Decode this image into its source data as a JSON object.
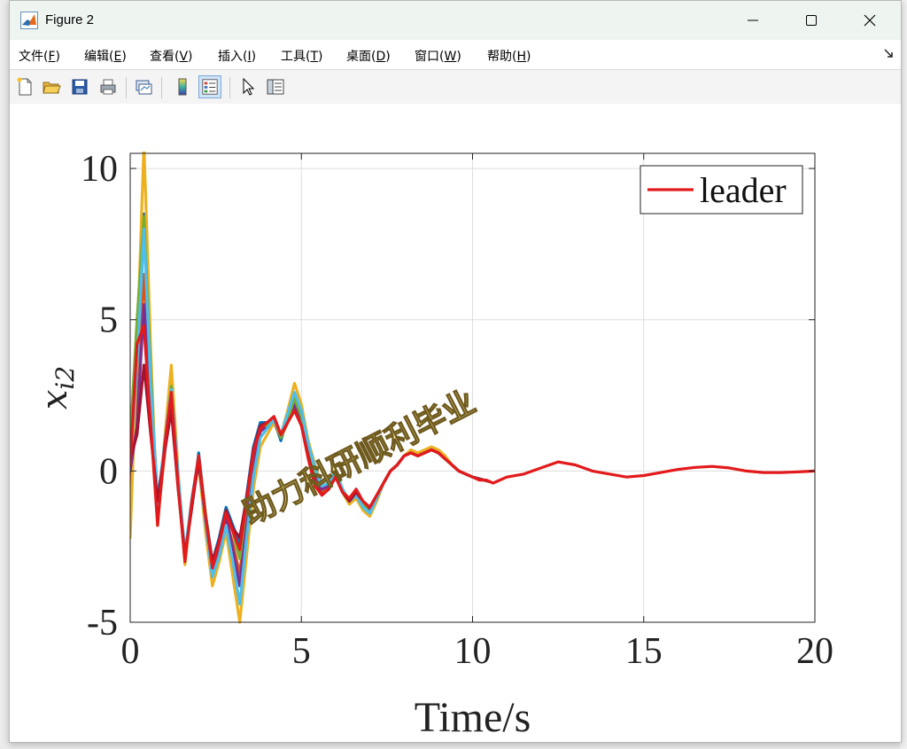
{
  "window": {
    "title": "Figure 2",
    "icons": {
      "app": "matlab-icon",
      "minimize": "minimize-icon",
      "maximize": "maximize-icon",
      "close": "close-icon"
    }
  },
  "menu": {
    "items": [
      {
        "label": "文件(",
        "key": "F",
        "tail": ")"
      },
      {
        "label": "编辑(",
        "key": "E",
        "tail": ")"
      },
      {
        "label": "查看(",
        "key": "V",
        "tail": ")"
      },
      {
        "label": "插入(",
        "key": "I",
        "tail": ")"
      },
      {
        "label": "工具(",
        "key": "T",
        "tail": ")"
      },
      {
        "label": "桌面(",
        "key": "D",
        "tail": ")"
      },
      {
        "label": "窗口(",
        "key": "W",
        "tail": ")"
      },
      {
        "label": "帮助(",
        "key": "H",
        "tail": ")"
      }
    ],
    "overflow_icon": "dock-arrow-icon"
  },
  "toolbar": {
    "tools": [
      "new-figure-icon",
      "open-file-icon",
      "save-icon",
      "print-icon",
      "link-plot-icon",
      "colorbar-icon",
      "legend-icon",
      "edit-plot-icon",
      "property-inspector-icon"
    ]
  },
  "watermark": "助力科研顺利毕业",
  "colors": {
    "leader": "#e31a1c",
    "accent_title": "#eef5f1"
  },
  "chart_data": {
    "type": "line",
    "xlabel": "Time/s",
    "ylabel": "x_{i2}",
    "xlim": [
      0,
      20
    ],
    "ylim": [
      -5,
      10.5
    ],
    "xticks": [
      0,
      5,
      10,
      15,
      20
    ],
    "xtick_labels": [
      "0",
      "5",
      "10",
      "15",
      "20"
    ],
    "yticks": [
      -5,
      0,
      5,
      10
    ],
    "ytick_labels": [
      "-5",
      "0",
      "5",
      "10"
    ],
    "grid": true,
    "legend": {
      "entries": [
        "leader"
      ],
      "position": "top-right"
    },
    "leader": {
      "name": "leader",
      "color": "#e31a1c",
      "x": [
        0,
        0.2,
        0.4,
        0.6,
        0.8,
        1,
        1.2,
        1.4,
        1.6,
        1.8,
        2,
        2.2,
        2.4,
        2.6,
        2.8,
        3,
        3.2,
        3.4,
        3.6,
        3.8,
        4,
        4.2,
        4.4,
        4.6,
        4.8,
        5,
        5.2,
        5.4,
        5.6,
        5.8,
        6,
        6.2,
        6.4,
        6.6,
        6.8,
        7,
        7.2,
        7.4,
        7.6,
        7.8,
        8,
        8.2,
        8.4,
        8.6,
        8.8,
        9,
        9.2,
        9.4,
        9.6,
        9.8,
        10,
        10.2,
        10.4,
        10.6,
        10.8,
        11,
        11.5,
        12,
        12.5,
        13,
        13.5,
        14,
        14.5,
        15,
        15.5,
        16,
        16.5,
        17,
        17.5,
        18,
        18.5,
        19,
        19.5,
        20
      ],
      "y": [
        0.2,
        4.2,
        4.8,
        1.5,
        -1.8,
        0.8,
        2.6,
        -0.5,
        -3.0,
        -1.0,
        0.5,
        -1.5,
        -3.2,
        -2.4,
        -1.4,
        -2.0,
        -2.6,
        -1.0,
        0.6,
        1.4,
        1.6,
        1.8,
        1.2,
        1.6,
        2.0,
        1.5,
        0.4,
        -0.5,
        -0.8,
        -0.6,
        -0.2,
        -0.7,
        -0.9,
        -0.6,
        -1.0,
        -1.2,
        -0.8,
        -0.4,
        0.0,
        0.2,
        0.5,
        0.6,
        0.5,
        0.6,
        0.7,
        0.6,
        0.4,
        0.2,
        0.0,
        -0.1,
        -0.2,
        -0.3,
        -0.3,
        -0.4,
        -0.3,
        -0.2,
        -0.1,
        0.1,
        0.3,
        0.2,
        0.0,
        -0.1,
        -0.2,
        -0.15,
        -0.05,
        0.05,
        0.12,
        0.15,
        0.1,
        0.0,
        -0.05,
        -0.05,
        -0.03,
        0.0
      ]
    },
    "followers": [
      {
        "color": "#0072bd",
        "x": [
          0,
          0.2,
          0.4,
          0.6,
          0.8,
          1,
          1.2,
          1.4,
          1.6,
          1.8,
          2,
          2.2,
          2.4,
          2.6,
          2.8,
          3,
          3.2,
          3.4,
          3.6,
          3.8,
          4,
          4.2,
          4.4,
          4.6,
          4.8,
          5,
          5.2,
          5.4,
          5.6,
          5.8,
          6,
          6.2,
          6.4,
          6.6,
          6.8,
          7,
          7.2,
          7.4,
          7.6,
          7.8,
          8,
          8.2,
          8.4,
          8.6,
          8.8,
          9,
          9.2,
          9.4,
          9.6,
          9.8,
          10,
          10.5
        ],
        "y": [
          0.5,
          2.0,
          8.5,
          3.0,
          -1.0,
          0.8,
          2.4,
          -0.2,
          -2.8,
          -1.2,
          0.6,
          -1.4,
          -3.0,
          -2.2,
          -1.2,
          -1.8,
          -2.4,
          -0.8,
          0.8,
          1.6,
          1.6,
          1.7,
          1.0,
          1.8,
          2.3,
          1.7,
          0.8,
          0.0,
          -0.5,
          -0.4,
          0.0,
          -0.6,
          -1.0,
          -0.8,
          -1.1,
          -1.3,
          -0.9,
          -0.4,
          0.0,
          0.2,
          0.5,
          0.6,
          0.5,
          0.6,
          0.7,
          0.6,
          0.4,
          0.2,
          0.0,
          -0.1,
          -0.2,
          -0.35
        ]
      },
      {
        "color": "#d95319",
        "x": [
          0,
          0.2,
          0.4,
          0.6,
          0.8,
          1,
          1.2,
          1.4,
          1.6,
          1.8,
          2,
          2.2,
          2.4,
          2.6,
          2.8,
          3,
          3.2,
          3.4,
          3.6,
          3.8,
          4,
          4.2,
          4.4,
          4.6,
          4.8,
          5,
          5.2,
          5.4,
          5.6,
          5.8,
          6,
          6.2,
          6.4,
          6.6,
          6.8,
          7,
          7.2,
          7.4,
          7.6,
          7.8,
          8,
          8.2,
          8.4,
          8.6,
          8.8,
          9,
          9.2,
          9.4,
          9.6,
          9.8,
          10,
          10.5
        ],
        "y": [
          -0.5,
          3.0,
          6.5,
          2.0,
          -1.6,
          0.5,
          3.0,
          -0.4,
          -3.0,
          -1.0,
          0.4,
          -1.6,
          -3.4,
          -2.6,
          -1.6,
          -2.4,
          -3.4,
          -1.4,
          0.4,
          1.4,
          1.5,
          1.6,
          1.1,
          1.6,
          2.1,
          1.6,
          0.6,
          -0.2,
          -0.7,
          -0.6,
          -0.1,
          -0.6,
          -1.0,
          -0.7,
          -1.1,
          -1.3,
          -0.9,
          -0.4,
          0.0,
          0.2,
          0.5,
          0.6,
          0.5,
          0.6,
          0.7,
          0.6,
          0.4,
          0.2,
          0.0,
          -0.1,
          -0.2,
          -0.35
        ]
      },
      {
        "color": "#edb120",
        "x": [
          0,
          0.2,
          0.4,
          0.6,
          0.8,
          1,
          1.2,
          1.4,
          1.6,
          1.8,
          2,
          2.2,
          2.4,
          2.6,
          2.8,
          3,
          3.2,
          3.4,
          3.6,
          3.8,
          4,
          4.2,
          4.4,
          4.6,
          4.8,
          5,
          5.2,
          5.4,
          5.6,
          5.8,
          6,
          6.2,
          6.4,
          6.6,
          6.8,
          7,
          7.2,
          7.4,
          7.6,
          7.8,
          8,
          8.2,
          8.4,
          8.6,
          8.8,
          9,
          9.2,
          9.4,
          9.6,
          9.8,
          10,
          10.5
        ],
        "y": [
          -2.2,
          4.0,
          10.8,
          4.0,
          -1.8,
          1.0,
          3.5,
          0.0,
          -3.1,
          -1.0,
          0.2,
          -2.0,
          -3.8,
          -3.0,
          -2.0,
          -3.5,
          -5.0,
          -2.8,
          -0.6,
          0.8,
          1.2,
          1.6,
          1.2,
          2.0,
          2.9,
          2.2,
          1.0,
          0.2,
          -0.5,
          -0.4,
          0.0,
          -0.7,
          -1.1,
          -0.9,
          -1.3,
          -1.5,
          -1.0,
          -0.4,
          0.0,
          0.2,
          0.5,
          0.7,
          0.6,
          0.7,
          0.8,
          0.7,
          0.5,
          0.2,
          0.0,
          -0.1,
          -0.2,
          -0.35
        ]
      },
      {
        "color": "#7e2f8e",
        "x": [
          0,
          0.2,
          0.4,
          0.6,
          0.8,
          1,
          1.2,
          1.4,
          1.6,
          1.8,
          2,
          2.2,
          2.4,
          2.6,
          2.8,
          3,
          3.2,
          3.4,
          3.6,
          3.8,
          4,
          4.2,
          4.4,
          4.6,
          4.8,
          5,
          5.2,
          5.4,
          5.6,
          5.8,
          6,
          6.2,
          6.4,
          6.6,
          6.8,
          7,
          7.2,
          7.4,
          7.6,
          7.8,
          8,
          8.2,
          8.4,
          8.6,
          8.8,
          9,
          9.2,
          9.4,
          9.6,
          9.8,
          10,
          10.5
        ],
        "y": [
          0.0,
          1.5,
          5.5,
          2.5,
          -1.2,
          0.6,
          2.2,
          -0.3,
          -2.9,
          -1.1,
          0.3,
          -1.6,
          -3.3,
          -2.5,
          -1.5,
          -2.6,
          -3.8,
          -1.6,
          0.2,
          1.3,
          1.5,
          1.7,
          1.1,
          1.7,
          2.2,
          1.6,
          0.7,
          -0.1,
          -0.6,
          -0.5,
          -0.1,
          -0.6,
          -1.0,
          -0.8,
          -1.1,
          -1.3,
          -0.9,
          -0.4,
          0.0,
          0.2,
          0.5,
          0.6,
          0.5,
          0.6,
          0.7,
          0.6,
          0.4,
          0.2,
          0.0,
          -0.1,
          -0.2,
          -0.35
        ]
      },
      {
        "color": "#77ac30",
        "x": [
          0,
          0.2,
          0.4,
          0.6,
          0.8,
          1,
          1.2,
          1.4,
          1.6,
          1.8,
          2,
          2.2,
          2.4,
          2.6,
          2.8,
          3,
          3.2,
          3.4,
          3.6,
          3.8,
          4,
          4.2,
          4.4,
          4.6,
          4.8,
          5,
          5.2,
          5.4,
          5.6,
          5.8,
          6,
          6.2,
          6.4,
          6.6,
          6.8,
          7,
          7.2,
          7.4,
          7.6,
          7.8,
          8,
          8.2,
          8.4,
          8.6,
          8.8,
          9,
          9.2,
          9.4,
          9.6,
          9.8,
          10,
          10.5
        ],
        "y": [
          1.0,
          5.0,
          8.4,
          3.2,
          -1.4,
          0.7,
          2.8,
          -0.2,
          -2.9,
          -1.0,
          0.5,
          -1.4,
          -3.1,
          -2.3,
          -1.3,
          -2.0,
          -2.9,
          -1.1,
          0.6,
          1.5,
          1.5,
          1.7,
          1.1,
          1.7,
          2.4,
          1.8,
          0.8,
          0.0,
          -0.5,
          -0.4,
          0.0,
          -0.6,
          -1.0,
          -0.8,
          -1.1,
          -1.4,
          -0.9,
          -0.4,
          0.0,
          0.2,
          0.5,
          0.6,
          0.5,
          0.6,
          0.7,
          0.6,
          0.4,
          0.2,
          0.0,
          -0.1,
          -0.2,
          -0.35
        ]
      },
      {
        "color": "#4dbeee",
        "x": [
          0,
          0.2,
          0.4,
          0.6,
          0.8,
          1,
          1.2,
          1.4,
          1.6,
          1.8,
          2,
          2.2,
          2.4,
          2.6,
          2.8,
          3,
          3.2,
          3.4,
          3.6,
          3.8,
          4,
          4.2,
          4.4,
          4.6,
          4.8,
          5,
          5.2,
          5.4,
          5.6,
          5.8,
          6,
          6.2,
          6.4,
          6.6,
          6.8,
          7,
          7.2,
          7.4,
          7.6,
          7.8,
          8,
          8.2,
          8.4,
          8.6,
          8.8,
          9,
          9.2,
          9.4,
          9.6,
          9.8,
          10,
          10.5
        ],
        "y": [
          0.3,
          3.5,
          8.0,
          2.8,
          -1.1,
          0.9,
          2.7,
          -0.1,
          -2.7,
          -0.9,
          0.5,
          -1.7,
          -3.5,
          -2.8,
          -1.8,
          -3.0,
          -4.4,
          -2.2,
          -0.2,
          1.1,
          1.4,
          1.7,
          1.2,
          1.9,
          2.6,
          2.0,
          0.9,
          0.1,
          -0.5,
          -0.4,
          0.0,
          -0.6,
          -1.0,
          -0.8,
          -1.2,
          -1.4,
          -0.9,
          -0.4,
          0.0,
          0.2,
          0.5,
          0.6,
          0.5,
          0.6,
          0.7,
          0.6,
          0.4,
          0.2,
          0.0,
          -0.1,
          -0.2,
          -0.35
        ]
      },
      {
        "color": "#a2142f",
        "x": [
          0,
          0.2,
          0.4,
          0.6,
          0.8,
          1,
          1.2,
          1.4,
          1.6,
          1.8,
          2,
          2.2,
          2.4,
          2.6,
          2.8,
          3,
          3.2,
          3.4,
          3.6,
          3.8,
          4,
          4.2,
          4.4,
          4.6,
          4.8,
          5,
          5.2,
          5.4,
          5.6,
          5.8,
          6,
          6.2,
          6.4,
          6.6,
          6.8,
          7,
          7.2,
          7.4,
          7.6,
          7.8,
          8,
          8.2,
          8.4,
          8.6,
          8.8,
          9,
          9.2,
          9.4,
          9.6,
          9.8,
          10,
          10.5
        ],
        "y": [
          0.4,
          1.2,
          3.5,
          1.2,
          -1.0,
          0.6,
          2.0,
          -0.6,
          -2.8,
          -1.2,
          0.4,
          -1.5,
          -3.0,
          -2.3,
          -1.3,
          -1.9,
          -2.2,
          -0.9,
          0.7,
          1.5,
          1.6,
          1.8,
          1.2,
          1.6,
          2.0,
          1.5,
          0.5,
          -0.4,
          -0.8,
          -0.6,
          -0.2,
          -0.7,
          -1.0,
          -0.7,
          -1.0,
          -1.2,
          -0.8,
          -0.4,
          0.0,
          0.2,
          0.5,
          0.6,
          0.5,
          0.6,
          0.7,
          0.6,
          0.4,
          0.2,
          0.0,
          -0.1,
          -0.2,
          -0.35
        ]
      }
    ]
  }
}
